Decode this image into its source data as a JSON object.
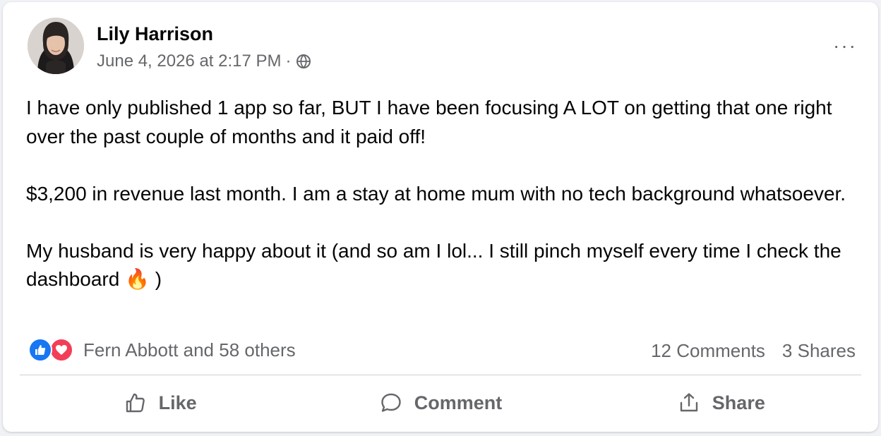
{
  "post": {
    "author": "Lily Harrison",
    "timestamp": "June 4, 2026 at 2:17 PM",
    "separator": "·",
    "privacy_icon": "globe-icon",
    "more_label": "···",
    "paragraphs": [
      "I have only published 1 app so far, BUT I have been focusing A LOT on getting that one right over the past couple of months and it paid off!",
      "$3,200 in revenue last month. I am a stay at home mum with no tech background whatsoever.",
      "My husband is very happy about it (and so am I lol... I still pinch myself every time I check the dashboard 🔥 )"
    ]
  },
  "engagement": {
    "reaction_icons": [
      "like-reaction-icon",
      "love-reaction-icon"
    ],
    "reactions_label": "Fern Abbott and 58 others",
    "comments_label": "12 Comments",
    "shares_label": "3 Shares"
  },
  "actions": {
    "like_label": "Like",
    "comment_label": "Comment",
    "share_label": "Share"
  },
  "colors": {
    "like_blue": "#1877f2",
    "love_red": "#f33e58",
    "secondary_text": "#65676b",
    "primary_text": "#050505"
  }
}
